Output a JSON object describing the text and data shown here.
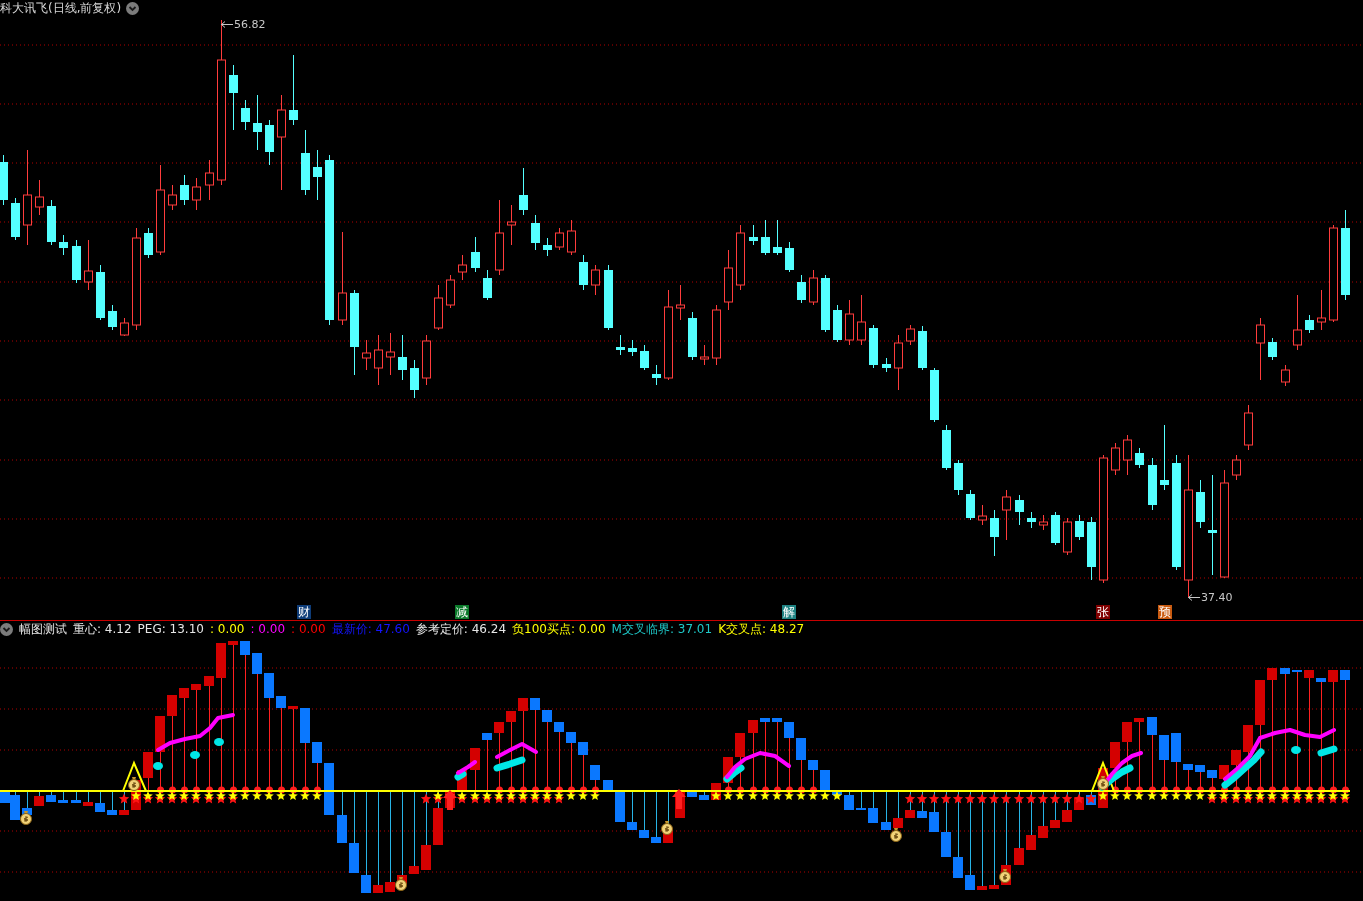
{
  "window": {
    "title": "科大讯飞(日线,前复权)"
  },
  "price_chart": {
    "high_label": "56.82",
    "low_label": "37.40",
    "event_tags": [
      {
        "text": "财",
        "color": "#0e3c78"
      },
      {
        "text": "减",
        "color": "#0a7a2a"
      },
      {
        "text": "解",
        "color": "#1e8282"
      },
      {
        "text": "张",
        "color": "#800000"
      },
      {
        "text": "预",
        "color": "#c85a10"
      }
    ]
  },
  "indicator": {
    "title": "幅图测试",
    "readings": [
      {
        "text": "重心: 4.12",
        "color": "#e6e6e6"
      },
      {
        "text": "PEG: 13.10",
        "color": "#e6e6e6"
      },
      {
        "text": ": 0.00",
        "color": "#ffff00"
      },
      {
        "text": ": 0.00",
        "color": "#ff00ff"
      },
      {
        "text": ": 0.00",
        "color": "#ff0000"
      },
      {
        "text": "最新价: 47.60",
        "color": "#1414ff"
      },
      {
        "text": "参考定价: 46.24",
        "color": "#e6e6e6"
      },
      {
        "text": "负100买点: 0.00",
        "color": "#ffff00"
      },
      {
        "text": "M交叉临界: 37.01",
        "color": "#1ec8c8"
      },
      {
        "text": "K交叉点: 48.27",
        "color": "#ffff00"
      }
    ]
  }
}
